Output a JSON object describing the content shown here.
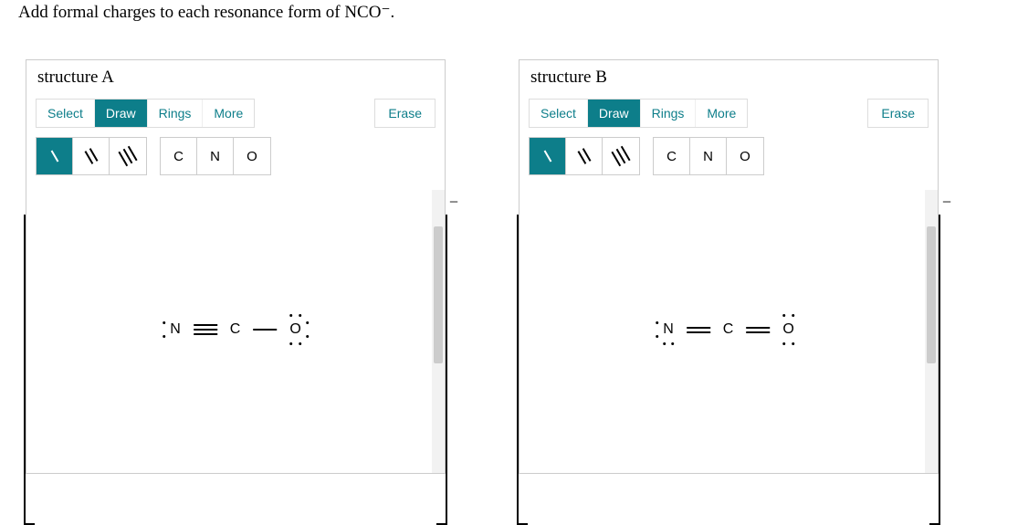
{
  "question": "Add formal charges to each resonance form of NCO⁻.",
  "structures": {
    "A": {
      "title": "structure A"
    },
    "B": {
      "title": "structure B"
    }
  },
  "toolbar": {
    "tabs": {
      "select": "Select",
      "draw": "Draw",
      "rings": "Rings",
      "more": "More"
    },
    "erase": "Erase",
    "atoms": {
      "c": "C",
      "n": "N",
      "o": "O"
    }
  },
  "atomsLabels": {
    "n": "N",
    "c": "C",
    "o": "O"
  }
}
